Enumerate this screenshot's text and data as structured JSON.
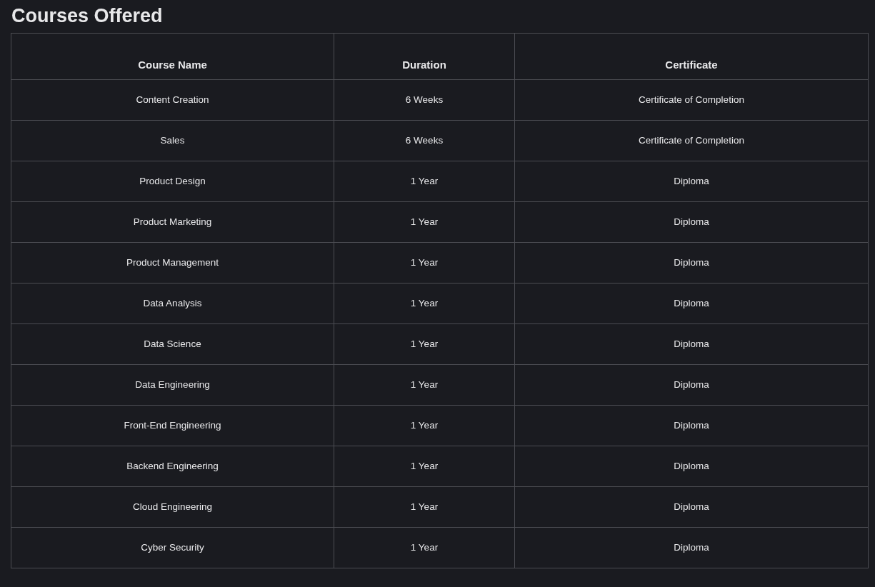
{
  "title": "Courses Offered",
  "table": {
    "columns": [
      "Course Name",
      "Duration",
      "Certificate"
    ],
    "rows": [
      [
        "Content Creation",
        "6 Weeks",
        "Certificate of Completion"
      ],
      [
        "Sales",
        "6 Weeks",
        "Certificate of Completion"
      ],
      [
        "Product Design",
        "1 Year",
        "Diploma"
      ],
      [
        "Product Marketing",
        "1 Year",
        "Diploma"
      ],
      [
        "Product Management",
        "1 Year",
        "Diploma"
      ],
      [
        "Data Analysis",
        "1 Year",
        "Diploma"
      ],
      [
        "Data Science",
        "1 Year",
        "Diploma"
      ],
      [
        "Data Engineering",
        "1 Year",
        "Diploma"
      ],
      [
        "Front-End Engineering",
        "1 Year",
        "Diploma"
      ],
      [
        "Backend Engineering",
        "1 Year",
        "Diploma"
      ],
      [
        "Cloud Engineering",
        "1 Year",
        "Diploma"
      ],
      [
        "Cyber Security",
        "1 Year",
        "Diploma"
      ]
    ]
  }
}
